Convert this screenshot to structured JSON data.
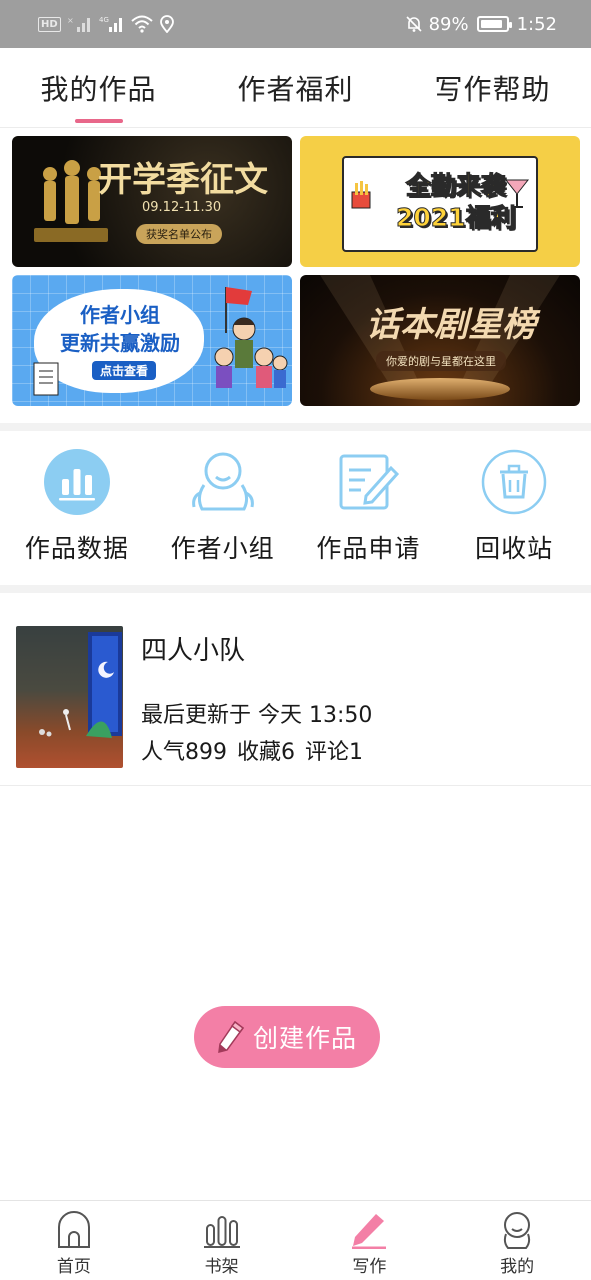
{
  "status_bar": {
    "hd": "HD",
    "network": "4G",
    "battery_percent": "89%",
    "battery_level": 0.89,
    "time": "1:52"
  },
  "top_tabs": [
    {
      "label": "我的作品",
      "active": true
    },
    {
      "label": "作者福利",
      "active": false
    },
    {
      "label": "写作帮助",
      "active": false
    }
  ],
  "banners": [
    {
      "title": "开学季征文",
      "date": "09.12-11.30",
      "pill": "获奖名单公布"
    },
    {
      "title_line1": "全勤来袭",
      "title_line2": "2021福利"
    },
    {
      "title_line1": "作者小组",
      "title_line2": "更新共赢激励",
      "pill": "点击查看"
    },
    {
      "title": "话本剧星榜",
      "subtitle": "你爱的剧与星都在这里"
    }
  ],
  "quick_actions": [
    {
      "label": "作品数据",
      "icon": "bar-chart-icon"
    },
    {
      "label": "作者小组",
      "icon": "group-icon"
    },
    {
      "label": "作品申请",
      "icon": "edit-document-icon"
    },
    {
      "label": "回收站",
      "icon": "trash-icon"
    }
  ],
  "works": [
    {
      "title": "四人小队",
      "updated": "最后更新于 今天 13:50",
      "popularity": "人气899",
      "favorites": "收藏6",
      "comments": "评论1"
    }
  ],
  "create_button": {
    "label": "创建作品",
    "icon": "pencil-icon"
  },
  "bottom_nav": [
    {
      "label": "首页",
      "icon": "home-icon",
      "active": false
    },
    {
      "label": "书架",
      "icon": "bookshelf-icon",
      "active": false
    },
    {
      "label": "写作",
      "icon": "pen-icon",
      "active": true
    },
    {
      "label": "我的",
      "icon": "profile-icon",
      "active": false
    }
  ],
  "colors": {
    "accent": "#e8678a",
    "create_button": "#f37fa6",
    "icon_blue": "#7cc4ee",
    "status_bar": "#9e9e9e"
  }
}
